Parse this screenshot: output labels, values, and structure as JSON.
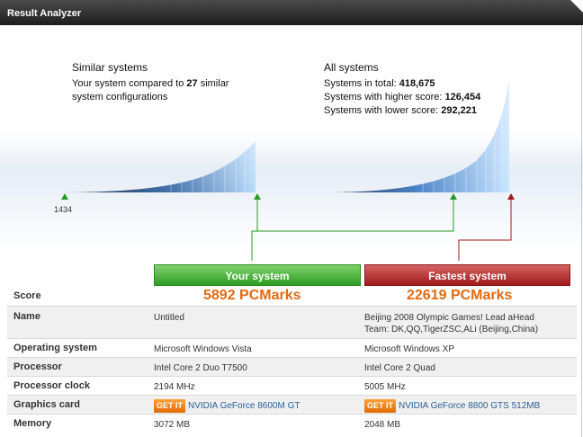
{
  "window": {
    "title": "Result Analyzer"
  },
  "similar": {
    "title": "Similar systems",
    "line1_prefix": "Your system compared to ",
    "count": "27",
    "line1_suffix": " similar",
    "line2": "system configurations",
    "min_label": "1434"
  },
  "all": {
    "title": "All systems",
    "total_label": "Systems in total: ",
    "total": "418,675",
    "higher_label": "Systems with higher score: ",
    "higher": "126,454",
    "lower_label": "Systems with lower score: ",
    "lower": "292,221"
  },
  "colors": {
    "your_system": "#2e9c22",
    "fastest_system": "#9e1a1a",
    "score_text": "#e06a12"
  },
  "columns": {
    "yours": "Your system",
    "fastest": "Fastest system"
  },
  "rows": {
    "score": {
      "label": "Score",
      "yours": "5892 PCMarks",
      "fastest": "22619 PCMarks"
    },
    "name": {
      "label": "Name",
      "yours": "Untitled",
      "fastest_1": "Beijing 2008 Olympic Games! Lead aHead",
      "fastest_2": "Team: DK,QQ,TigerZSC,ALi (Beijing,China)"
    },
    "os": {
      "label": "Operating system",
      "yours": "Microsoft Windows Vista",
      "fastest": "Microsoft Windows XP"
    },
    "cpu": {
      "label": "Processor",
      "yours": "Intel Core 2 Duo T7500",
      "fastest": "Intel Core 2 Quad"
    },
    "clock": {
      "label": "Processor clock",
      "yours": "2194 MHz",
      "fastest": "5005 MHz"
    },
    "gpu": {
      "label": "Graphics card",
      "getit": "GET IT",
      "yours": "NVIDIA GeForce 8600M GT",
      "fastest": "NVIDIA GeForce 8800 GTS 512MB"
    },
    "mem": {
      "label": "Memory",
      "yours": "3072 MB",
      "fastest": "2048 MB"
    }
  }
}
